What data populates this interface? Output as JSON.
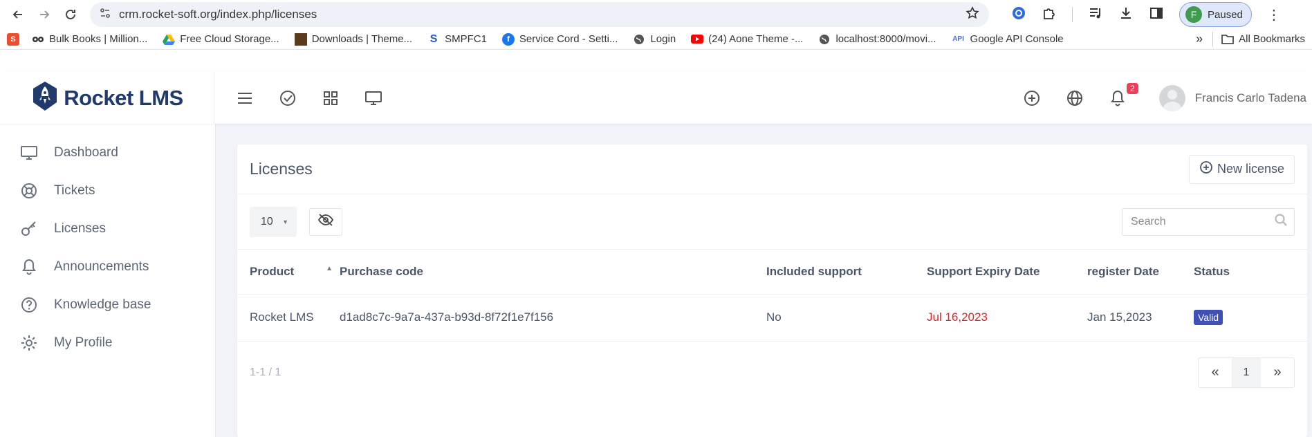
{
  "browser": {
    "url": "crm.rocket-soft.org/index.php/licenses",
    "profile_initial": "F",
    "profile_status": "Paused"
  },
  "bookmarks": [
    {
      "label": "Bulk Books | Million...",
      "icon": "glasses-icon"
    },
    {
      "label": "Free Cloud Storage...",
      "icon": "drive-icon"
    },
    {
      "label": "Downloads | Theme...",
      "icon": "theme-icon"
    },
    {
      "label": "SMPFC1",
      "icon": "s-icon"
    },
    {
      "label": "Service Cord - Setti...",
      "icon": "facebook-icon"
    },
    {
      "label": "Login",
      "icon": "globe-icon"
    },
    {
      "label": "(24) Aone Theme -...",
      "icon": "youtube-icon"
    },
    {
      "label": "localhost:8000/movi...",
      "icon": "globe-icon"
    },
    {
      "label": "Google API Console",
      "icon": "api-icon"
    }
  ],
  "bookmarks_all_label": "All Bookmarks",
  "app": {
    "logo_text": "Rocket LMS",
    "notification_count": "2",
    "user_name": "Francis Carlo Tadena"
  },
  "sidebar": {
    "items": [
      {
        "label": "Dashboard",
        "icon": "monitor-icon"
      },
      {
        "label": "Tickets",
        "icon": "lifebuoy-icon"
      },
      {
        "label": "Licenses",
        "icon": "key-icon"
      },
      {
        "label": "Announcements",
        "icon": "bell-icon"
      },
      {
        "label": "Knowledge base",
        "icon": "help-circle-icon"
      },
      {
        "label": "My Profile",
        "icon": "gear-icon"
      }
    ]
  },
  "page": {
    "title": "Licenses",
    "new_button_label": "New license",
    "page_length": "10",
    "search_placeholder": "Search",
    "columns": [
      "Product",
      "Purchase code",
      "Included support",
      "Support Expiry Date",
      "register Date",
      "Status"
    ],
    "rows": [
      {
        "product": "Rocket LMS",
        "purchase_code": "d1ad8c7c-9a7a-437a-b93d-8f72f1e7f156",
        "included_support": "No",
        "support_expiry": "Jul 16,2023",
        "register_date": "Jan 15,2023",
        "status": "Valid"
      }
    ],
    "count_info": "1-1 / 1",
    "pager": {
      "prev": "«",
      "current": "1",
      "next": "»"
    }
  },
  "colors": {
    "status_valid": "#3f51b5",
    "expiry_red": "#e3242b",
    "notification_badge": "#ef3e5a",
    "logo_navy": "#1f3a6b"
  }
}
